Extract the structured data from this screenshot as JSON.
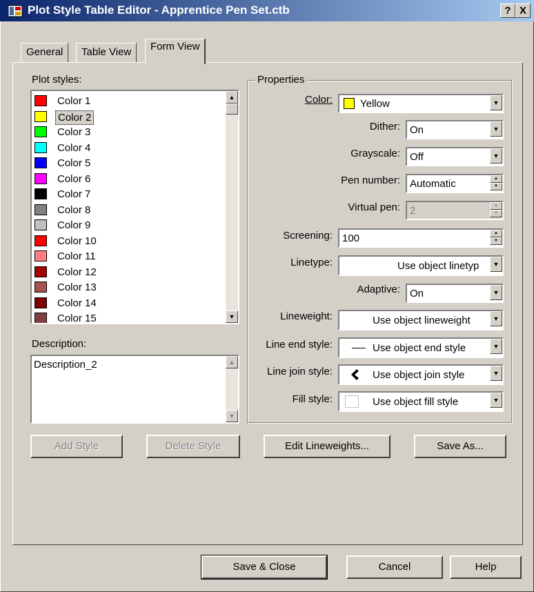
{
  "window": {
    "title": "Plot Style Table Editor - Apprentice Pen Set.ctb",
    "help_glyph": "?",
    "close_glyph": "X"
  },
  "tabs": [
    {
      "label": "General"
    },
    {
      "label": "Table View"
    },
    {
      "label": "Form View"
    }
  ],
  "plot_styles": {
    "label": "Plot styles:",
    "items": [
      {
        "name": "Color 1",
        "color": "#ff0000"
      },
      {
        "name": "Color 2",
        "color": "#ffff00"
      },
      {
        "name": "Color 3",
        "color": "#00ff00"
      },
      {
        "name": "Color 4",
        "color": "#00ffff"
      },
      {
        "name": "Color 5",
        "color": "#0000ff"
      },
      {
        "name": "Color 6",
        "color": "#ff00ff"
      },
      {
        "name": "Color 7",
        "color": "#000000"
      },
      {
        "name": "Color 8",
        "color": "#808080"
      },
      {
        "name": "Color 9",
        "color": "#c0c0c0"
      },
      {
        "name": "Color 10",
        "color": "#ff0000"
      },
      {
        "name": "Color 11",
        "color": "#ff7f7f"
      },
      {
        "name": "Color 12",
        "color": "#a50000"
      },
      {
        "name": "Color 13",
        "color": "#a55252"
      },
      {
        "name": "Color 14",
        "color": "#7f0000"
      },
      {
        "name": "Color 15",
        "color": "#7f3f3f"
      }
    ],
    "selected_index": 1
  },
  "description": {
    "label": "Description:",
    "value": "Description_2"
  },
  "properties": {
    "title": "Properties",
    "color": {
      "label": "Color:",
      "value": "Yellow",
      "swatch": "#ffff00"
    },
    "dither": {
      "label": "Dither:",
      "value": "On"
    },
    "grayscale": {
      "label": "Grayscale:",
      "value": "Off"
    },
    "pen_number": {
      "label": "Pen number:",
      "value": "Automatic"
    },
    "virtual_pen": {
      "label": "Virtual pen:",
      "value": "2"
    },
    "screening": {
      "label": "Screening:",
      "value": "100"
    },
    "linetype": {
      "label": "Linetype:",
      "value": "Use object linetyp"
    },
    "adaptive": {
      "label": "Adaptive:",
      "value": "On"
    },
    "lineweight": {
      "label": "Lineweight:",
      "value": "Use object lineweight"
    },
    "line_end_style": {
      "label": "Line end style:",
      "value": "Use object end style"
    },
    "line_join_style": {
      "label": "Line join style:",
      "value": "Use object join style"
    },
    "fill_style": {
      "label": "Fill style:",
      "value": "Use object fill style"
    }
  },
  "buttons": {
    "add_style": "Add Style",
    "delete_style": "Delete Style",
    "edit_lineweights": "Edit Lineweights...",
    "save_as": "Save As...",
    "save_close": "Save & Close",
    "cancel": "Cancel",
    "help": "Help"
  }
}
